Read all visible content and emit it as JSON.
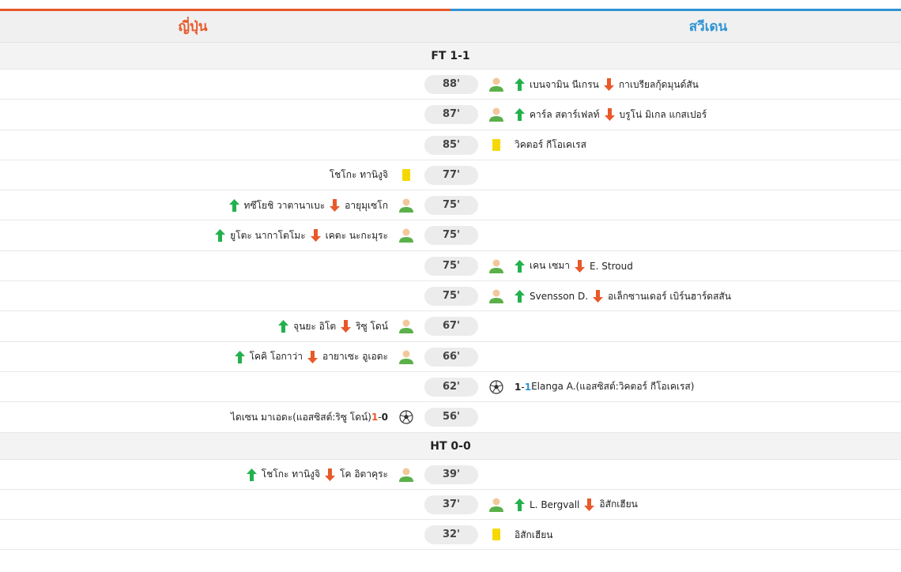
{
  "teams": {
    "home": "ญี่ปุ่น",
    "away": "สวีเดน"
  },
  "colors": {
    "home": "#e8592a",
    "away": "#2e93d5",
    "card_yellow": "#f6d800",
    "sub_in": "#22b14c",
    "sub_out": "#e8592a"
  },
  "ft_label": "FT 1-1",
  "ht_label": "HT 0-0",
  "events": [
    {
      "minute": "88'",
      "side": "away",
      "type": "sub",
      "in": "เบนจามิน นีเกรน",
      "out": "กาเบรียลกุ้ดมุนด์สัน"
    },
    {
      "minute": "87'",
      "side": "away",
      "type": "sub",
      "in": "คาร์ล สตาร์เฟลท์",
      "out": "บรูโน่ มิเกล แกสเปอร์"
    },
    {
      "minute": "85'",
      "side": "away",
      "type": "yellow",
      "player": "วิคตอร์ กีโอเคเรส"
    },
    {
      "minute": "77'",
      "side": "home",
      "type": "yellow",
      "player": "โชโกะ ทานิงูจิ"
    },
    {
      "minute": "75'",
      "side": "home",
      "type": "sub",
      "in": "ทซึโยชิ วาตานาเบะ",
      "out": "อายุมุเซโก"
    },
    {
      "minute": "75'",
      "side": "home",
      "type": "sub",
      "in": "ยูโตะ นากาโตโมะ",
      "out": "เคตะ นะกะมุระ"
    },
    {
      "minute": "75'",
      "side": "away",
      "type": "sub",
      "in": "เคน เซมา",
      "out": "E. Stroud"
    },
    {
      "minute": "75'",
      "side": "away",
      "type": "sub",
      "in": "Svensson D.",
      "out": "อเล็กซานเดอร์ เบิร์นฮาร์ดสสัน"
    },
    {
      "minute": "67'",
      "side": "home",
      "type": "sub",
      "in": "จุนยะ อิโต",
      "out": "ริซู โดน์"
    },
    {
      "minute": "66'",
      "side": "home",
      "type": "sub",
      "in": "โคคิ โอกาว่า",
      "out": "อายาเซะ อูเอดะ"
    },
    {
      "minute": "62'",
      "side": "away",
      "type": "goal",
      "home_score": "1",
      "away_score": "1",
      "player": "Elanga A.(แอสซิสต์:วิคตอร์ กีโอเคเรส)"
    },
    {
      "minute": "56'",
      "side": "home",
      "type": "goal",
      "home_score": "1",
      "away_score": "0",
      "player": "ไดเซน มาเอดะ(แอสซิสต์:ริซู โดน์)"
    },
    {
      "minute": "39'",
      "side": "home",
      "type": "sub",
      "in": "โชโกะ ทานิงูจิ",
      "out": "โค อิตาคุระ"
    },
    {
      "minute": "37'",
      "side": "away",
      "type": "sub",
      "in": "L. Bergvall",
      "out": "อิสักเฮียน"
    },
    {
      "minute": "32'",
      "side": "away",
      "type": "yellow",
      "player": "อิสักเฮียน"
    }
  ]
}
